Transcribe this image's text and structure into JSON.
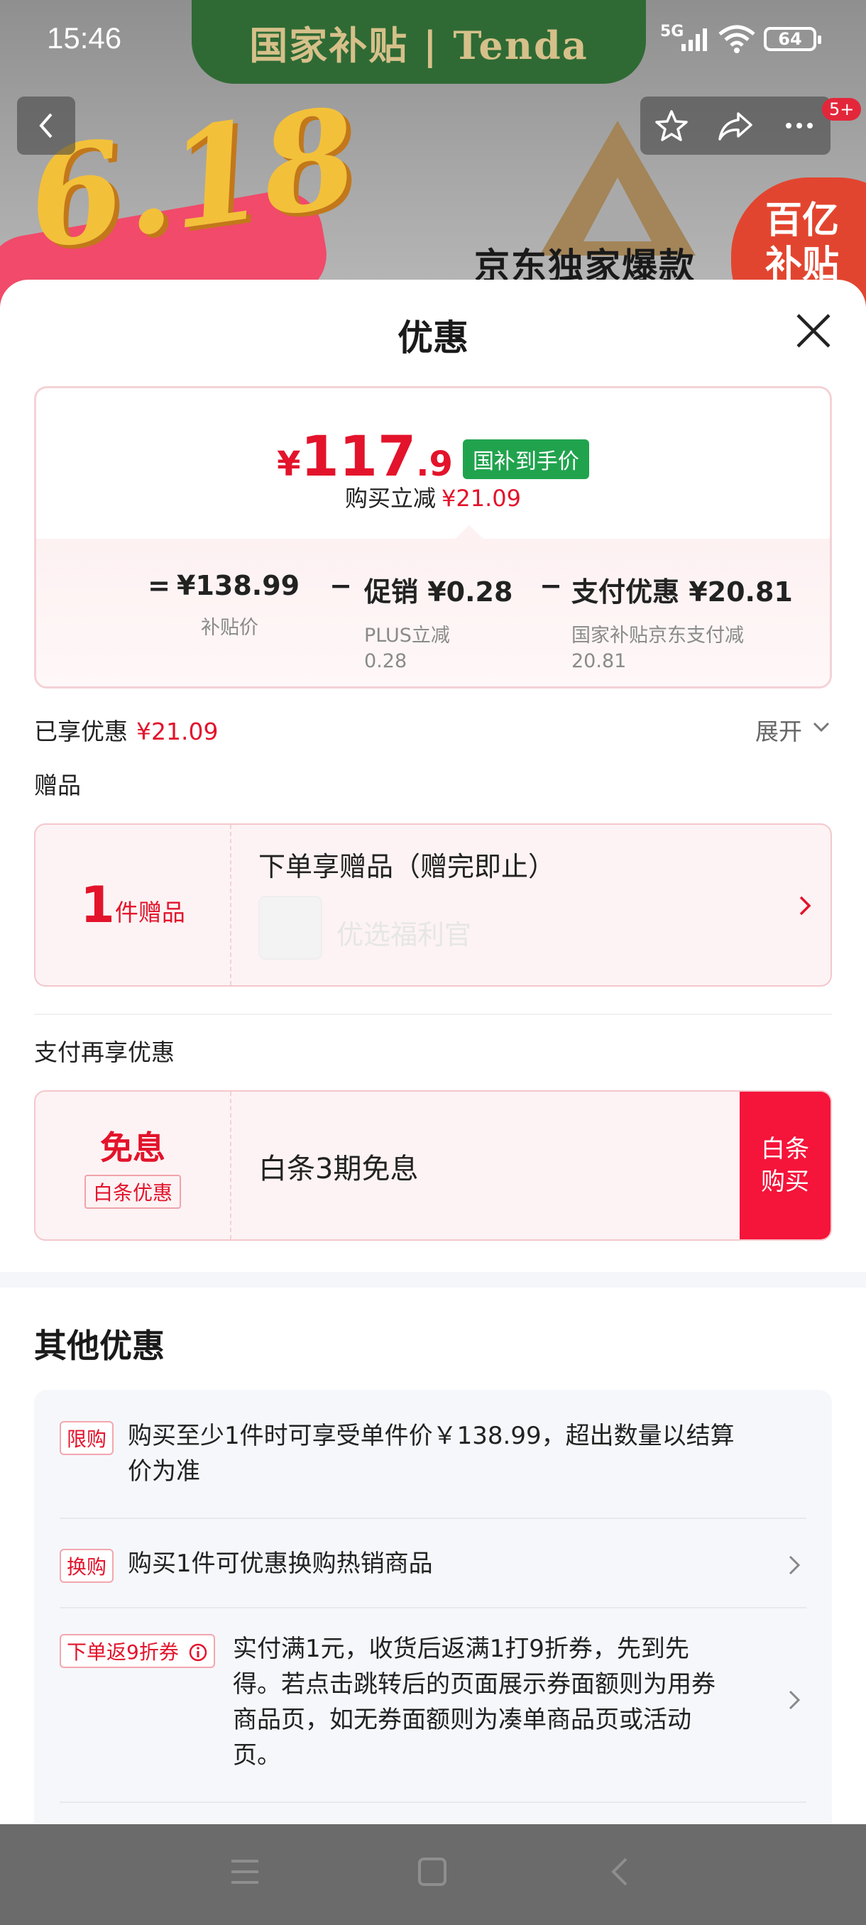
{
  "status_bar": {
    "time": "15:46",
    "network": "5G",
    "battery": "64"
  },
  "banner": {
    "brand": "国家补贴 | Tenda",
    "promo": "6.18",
    "exclusive": "京东独家爆款",
    "subsidy_line1": "百亿",
    "subsidy_line2": "补贴",
    "badge": "5+"
  },
  "sheet": {
    "title": "优惠",
    "price": {
      "currency": "¥",
      "integer": "117",
      "decimal": ".9",
      "tag": "国补到手价"
    },
    "discount": {
      "label": "购买立减",
      "amount": "¥21.09"
    },
    "formula": {
      "eq": "=",
      "minus1": "−",
      "minus2": "−",
      "terms": [
        {
          "value": "¥138.99",
          "sub": "补贴价",
          "sub2": ""
        },
        {
          "value": "促销 ¥0.28",
          "sub": "PLUS立减",
          "sub2": "0.28"
        },
        {
          "value": "支付优惠 ¥20.81",
          "sub": "国家补贴京东支付减",
          "sub2": "20.81"
        }
      ]
    },
    "enjoyed": {
      "label": "已享优惠",
      "amount": "¥21.09",
      "expand": "展开"
    },
    "gift_section": "赠品",
    "gift": {
      "count": "1",
      "unit": "件赠品",
      "title": "下单享赠品（赠完即止）",
      "shop": "优选福利官"
    },
    "pay_section": "支付再享优惠",
    "pay": {
      "big": "免息",
      "small": "白条优惠",
      "desc": "白条3期免息",
      "btn_line1": "白条",
      "btn_line2": "购买"
    },
    "other_title": "其他优惠",
    "other_items": [
      {
        "tag": "限购",
        "line1": "购买至少1件时可享受单件价￥138.99，超出数量以结算",
        "line2": "价为准"
      },
      {
        "tag": "换购",
        "line1": "购买1件可优惠换购热销商品"
      },
      {
        "tag": "下单返9折券",
        "line1": "实付满1元，收货后返满1打9折券，先到先",
        "line2": "得。若点击跳转后的页面展示券面额则为用券",
        "line3": "商品页，如无券面额则为凑单商品页或活动",
        "line4": "页。"
      }
    ]
  },
  "colors": {
    "accent_red": "#e3132b",
    "tag_green": "#21a34e",
    "buy_red": "#f5143a"
  }
}
